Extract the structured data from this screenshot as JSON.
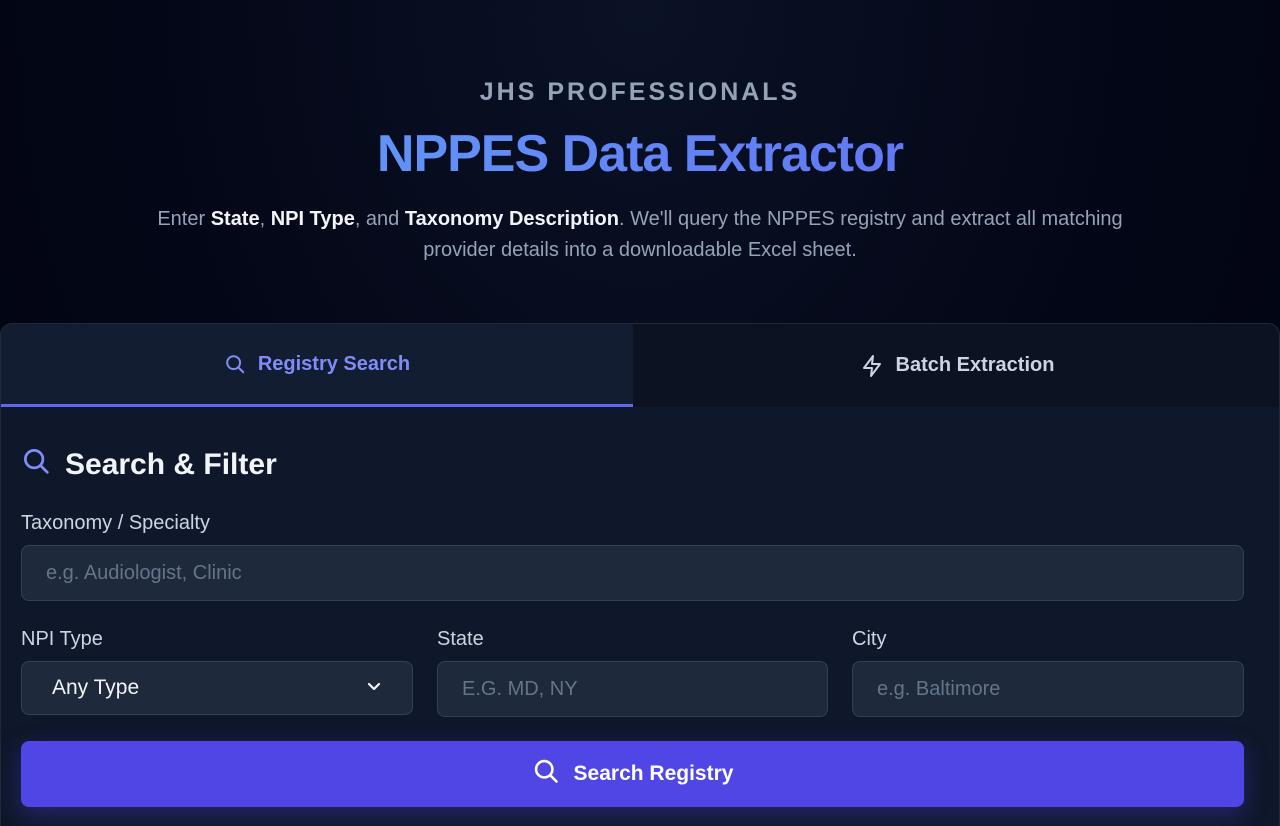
{
  "hero": {
    "eyebrow": "JHS PROFESSIONALS",
    "title": "NPPES Data Extractor",
    "subtitle": {
      "t1": "Enter ",
      "b1": "State",
      "t2": ", ",
      "b2": "NPI Type",
      "t3": ", and ",
      "b3": "Taxonomy Description",
      "t4": ". We'll query the NPPES registry and extract all matching provider details into a downloadable Excel sheet."
    }
  },
  "tabs": [
    {
      "label": "Registry Search",
      "icon": "search-icon",
      "active": true
    },
    {
      "label": "Batch Extraction",
      "icon": "lightning-icon",
      "active": false
    }
  ],
  "form": {
    "section_title": "Search & Filter",
    "taxonomy": {
      "label": "Taxonomy / Specialty",
      "placeholder": "e.g. Audiologist, Clinic",
      "value": ""
    },
    "npi_type": {
      "label": "NPI Type",
      "selected": "Any Type"
    },
    "state": {
      "label": "State",
      "placeholder": "E.G. MD, NY",
      "value": ""
    },
    "city": {
      "label": "City",
      "placeholder": "e.g. Baltimore",
      "value": ""
    },
    "submit_label": "Search Registry"
  },
  "colors": {
    "accent": "#6366f1",
    "button": "#4f46e5",
    "title_gradient_start": "#60a5fa",
    "title_gradient_end": "#6366f1",
    "background": "#020617"
  }
}
